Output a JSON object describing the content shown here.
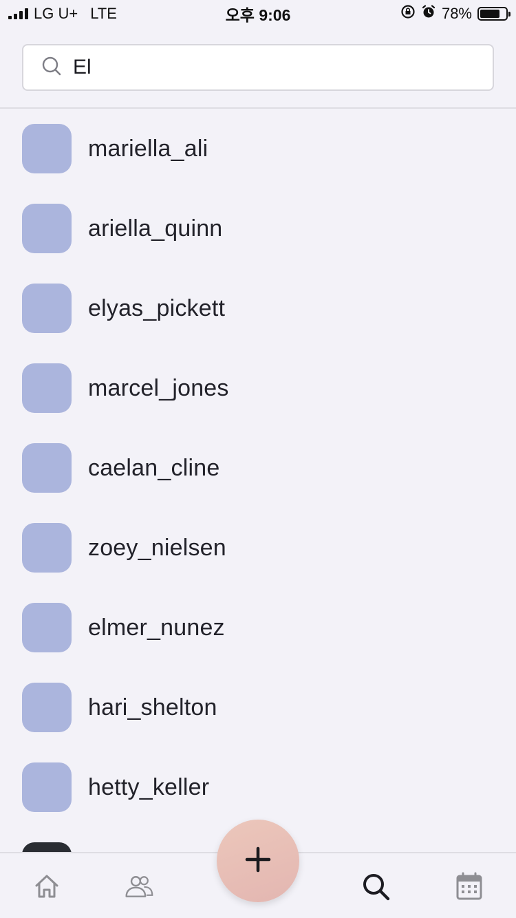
{
  "status_bar": {
    "carrier": "LG U+",
    "network": "LTE",
    "time": "오후 9:06",
    "battery": "78%",
    "battery_level": 0.78,
    "icons": [
      "signal-icon",
      "rotation-lock-icon",
      "alarm-icon",
      "battery-icon"
    ]
  },
  "search": {
    "value": "El",
    "icon": "search-icon"
  },
  "results": [
    {
      "username": "mariella_ali"
    },
    {
      "username": "ariella_quinn"
    },
    {
      "username": "elyas_pickett"
    },
    {
      "username": "marcel_jones"
    },
    {
      "username": "caelan_cline"
    },
    {
      "username": "zoey_nielsen"
    },
    {
      "username": "elmer_nunez"
    },
    {
      "username": "hari_shelton"
    },
    {
      "username": "hetty_keller"
    }
  ],
  "tab_bar": {
    "items": [
      {
        "icon": "home-icon",
        "active": false
      },
      {
        "icon": "people-icon",
        "active": false
      },
      {
        "icon": "plus-icon",
        "active": false
      },
      {
        "icon": "search-icon",
        "active": true
      },
      {
        "icon": "calendar-icon",
        "active": false
      }
    ]
  },
  "colors": {
    "background": "#f3f2f8",
    "avatar_placeholder": "#abb5dd",
    "fab_gradient_start": "#ecc7bb",
    "fab_gradient_end": "#e3b6b1",
    "icon_inactive": "#8e8e93",
    "icon_active": "#1c1c22"
  }
}
